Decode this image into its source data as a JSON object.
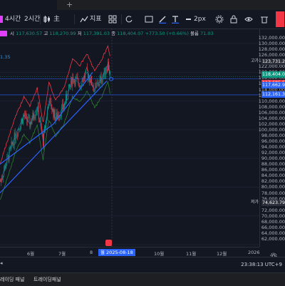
{
  "toolbar": {
    "timeframe_1": "4시간",
    "timeframe_2": "2시간",
    "chart_type": "主",
    "indicators_label": "지표",
    "stroke_width": "2px"
  },
  "ohlc": {
    "open_label": "시",
    "open": "117,630.57",
    "high_label": "고",
    "high": "118,270.99",
    "low_label": "저",
    "low": "117,391.03",
    "close_label": "종",
    "close": "118,404.07",
    "change": "+773.50 (+0.66%)",
    "volume_label": "볼륨",
    "volume": "71.03"
  },
  "indicator_value": "1.35",
  "price_axis": {
    "ticks": [
      "132,000.00",
      "130,000.00",
      "128,000.00",
      "126,000.00",
      "124,000.00",
      "122,000.00",
      "120,000.00",
      "118,000.00",
      "116,000.00",
      "114,000.00",
      "112,000.00",
      "110,000.00",
      "108,000.00",
      "106,000.00",
      "104,000.00",
      "102,000.00",
      "100,000.00",
      "98,000.00",
      "96,000.00",
      "94,000.00",
      "92,000.00",
      "90,000.00",
      "88,000.00",
      "86,000.00",
      "84,000.00",
      "82,000.00",
      "80,000.00",
      "78,000.00",
      "76,000.00",
      "74,000.00",
      "72,000.00",
      "70,000.00",
      "68,000.00",
      "66,000.00",
      "64,000.00",
      "62,000.00",
      "60,000.00"
    ],
    "high_tag": "고가",
    "high_price": "123,731.21",
    "last_price": "118,404.07",
    "last_price_2": "117,685.53",
    "mid_price": "117,662.91",
    "low_blue_price": "112,161.35",
    "low_tag": "저가",
    "low_price": "74,623.79"
  },
  "time_axis": {
    "ticks": [
      "5",
      "6월",
      "7월",
      "8",
      "10월",
      "11월",
      "12월",
      "2026"
    ],
    "current": "월 2025-08-18"
  },
  "clock": "23:38:13 UTC+9",
  "footer": {
    "tab1": "레이딩 패널",
    "tab2": "트레이딩패널"
  },
  "colors": {
    "background": "#131722",
    "up": "#089981",
    "down": "#f23645",
    "bands": "#f23645",
    "band_lower": "#2e7d32",
    "trendline": "#2962ff",
    "accent": "#2962ff"
  }
}
